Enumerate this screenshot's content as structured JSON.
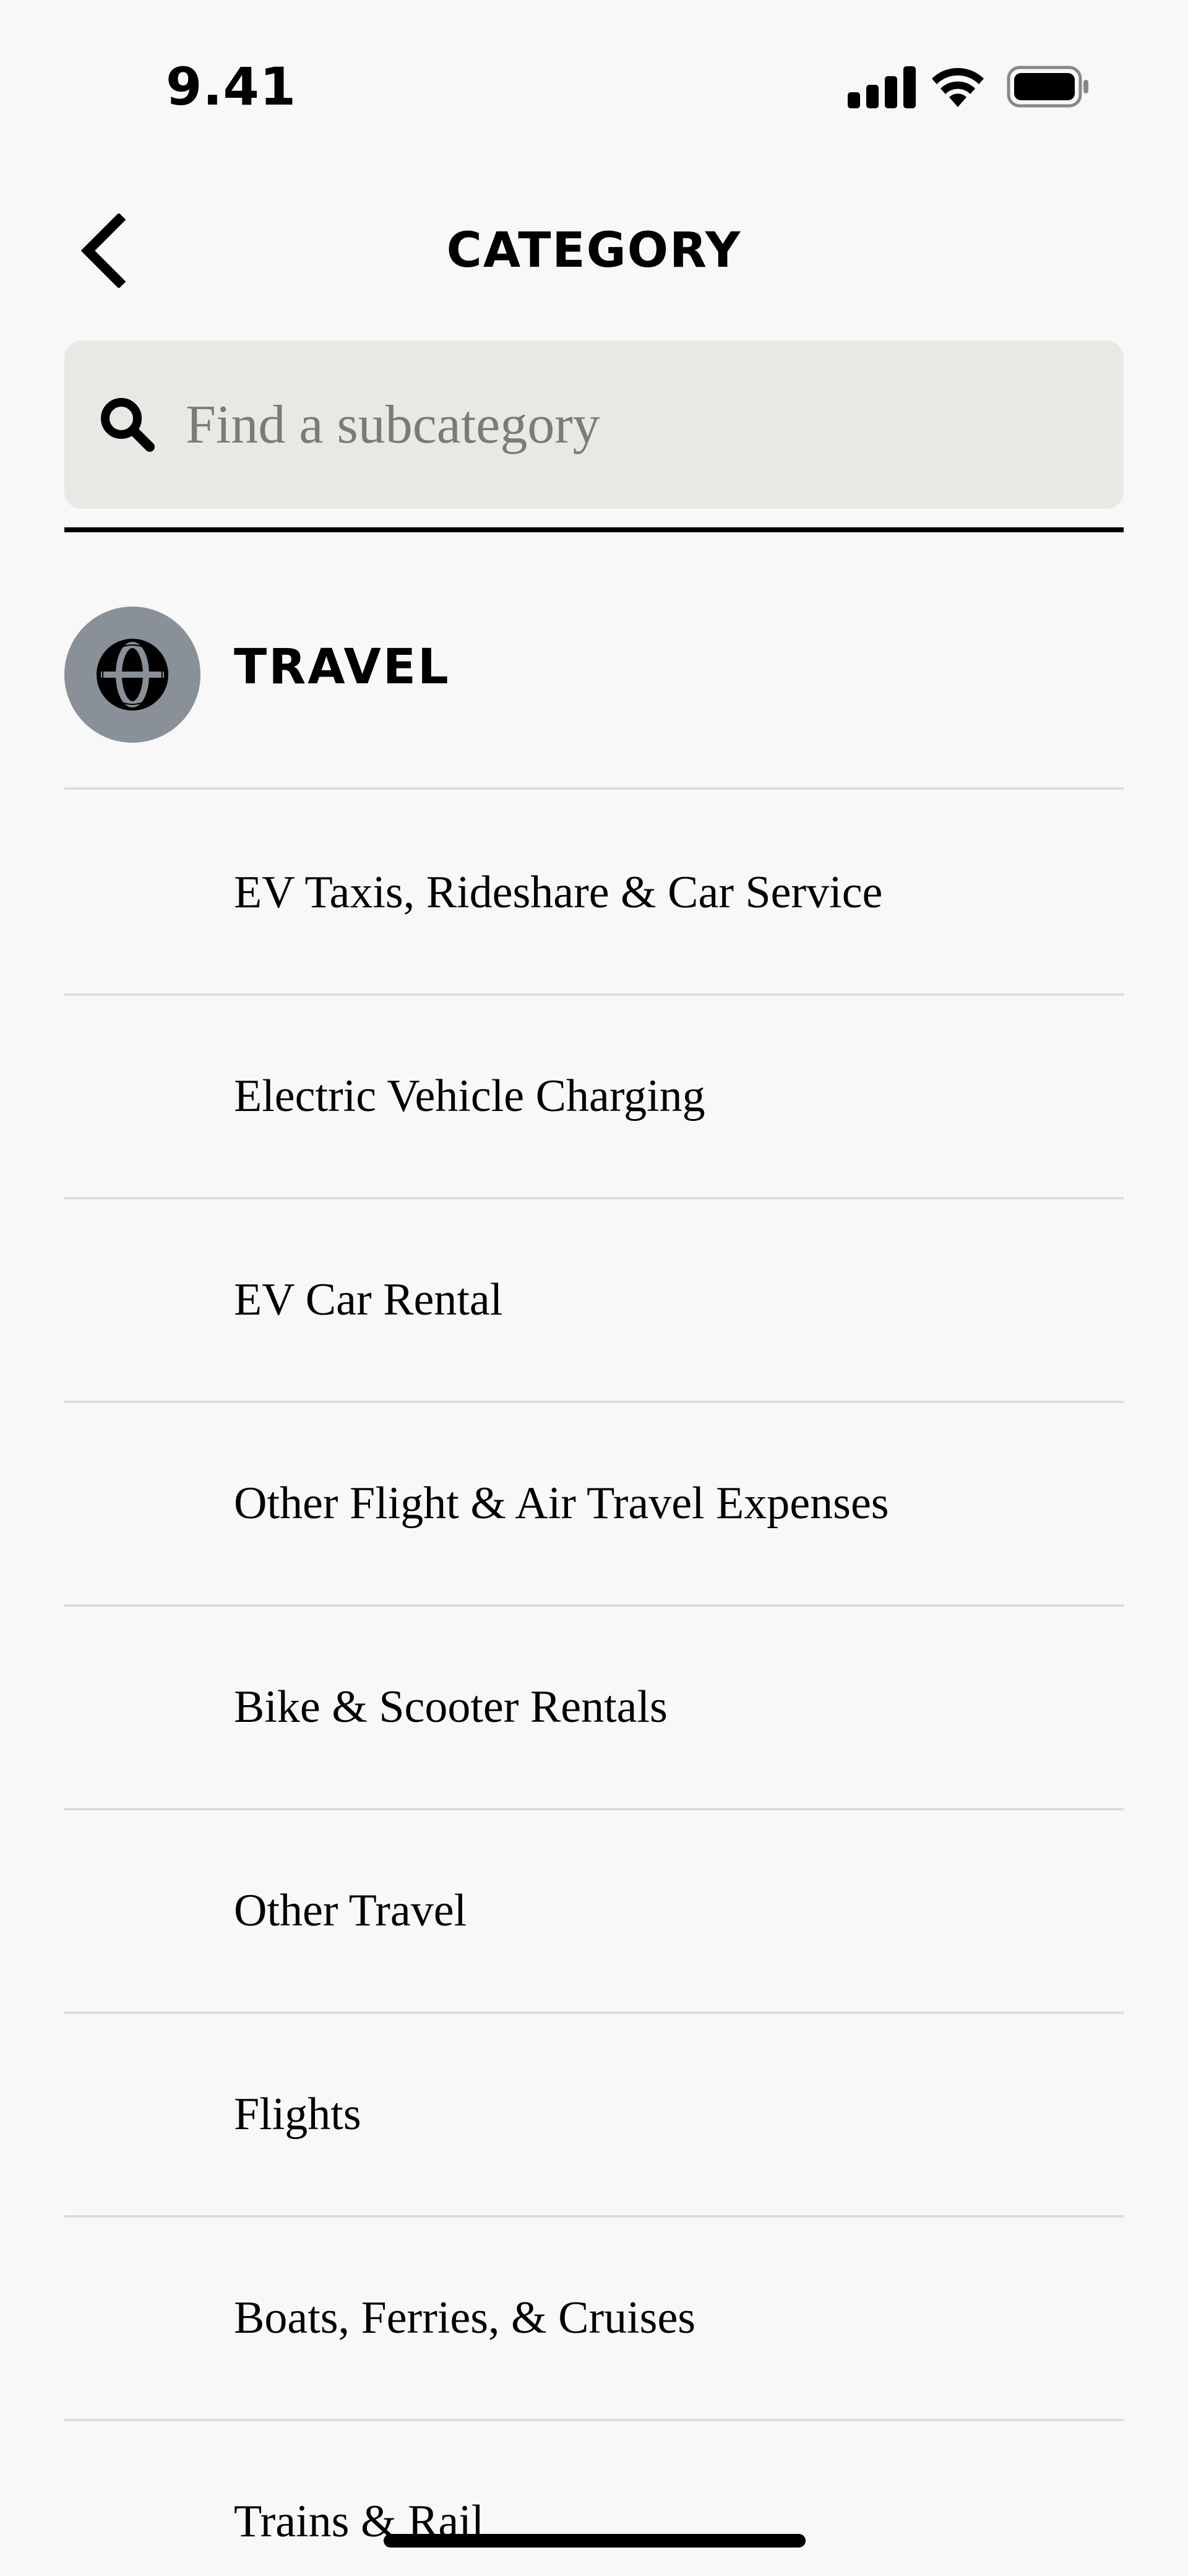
{
  "status_bar": {
    "time": "9.41",
    "icons": [
      "signal-icon",
      "wifi-icon",
      "battery-icon"
    ]
  },
  "header": {
    "title": "CATEGORY",
    "back_icon": "chevron-left-icon"
  },
  "search": {
    "placeholder": "Find a subcategory",
    "value": "",
    "icon": "search-icon"
  },
  "category": {
    "name": "TRAVEL",
    "icon": "globe-icon",
    "avatar_color": "#8a9098"
  },
  "subcategories": [
    {
      "label": "EV Taxis, Rideshare & Car Service"
    },
    {
      "label": "Electric Vehicle Charging"
    },
    {
      "label": "EV Car Rental"
    },
    {
      "label": "Other Flight & Air Travel Expenses"
    },
    {
      "label": "Bike & Scooter Rentals"
    },
    {
      "label": "Other Travel"
    },
    {
      "label": "Flights"
    },
    {
      "label": "Boats, Ferries, & Cruises"
    },
    {
      "label": "Trains & Rail"
    }
  ],
  "colors": {
    "background": "#f8f8f8",
    "search_background": "#e9e8e4",
    "divider": "#dcdcdc",
    "text": "#000000",
    "placeholder": "#7c7b77"
  }
}
